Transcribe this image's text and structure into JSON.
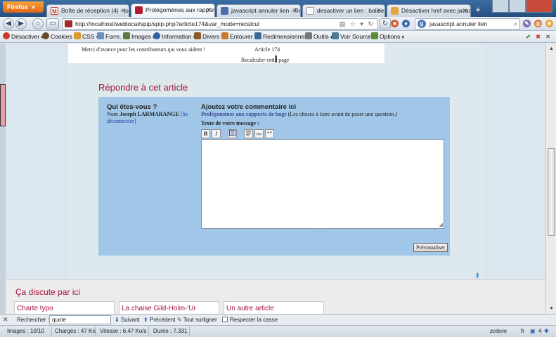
{
  "browser": {
    "menu_button": "Firefox",
    "tabs": [
      {
        "label": "Boîte de réception (4) - jose...",
        "favicon": "gmail-icon",
        "active": false
      },
      {
        "label": "Prolégomènes aux rapports...",
        "favicon": "spip-icon",
        "active": true
      },
      {
        "label": "javascript annuler lien - Rec...",
        "favicon": "page-icon",
        "active": false
      },
      {
        "label": "desactiver un lien : balise \"a...",
        "favicon": "page-icon",
        "active": false
      },
      {
        "label": "Désactiver href avec javascr...",
        "favicon": "page-icon",
        "active": false
      }
    ],
    "new_tab": "+",
    "url": "http://localhost/weblocal/spip/spip.php?article174&var_mode=recalcul",
    "search_value": "javascript annuler lien"
  },
  "dev_toolbar": {
    "items": [
      "Désactiver",
      "Cookies",
      "CSS",
      "Form.",
      "Images",
      "Information",
      "Divers",
      "Entourer",
      "Redimensionner",
      "Outils",
      "Voir Source",
      "Options"
    ]
  },
  "page": {
    "thanks_text": "Merci d'avance pour les contributeurs qui vous aident !",
    "article_number": "Article 174",
    "recalc_text": "Recalculer cette page",
    "reply_title": "Répondre à cet article",
    "who_title": "Qui êtes-vous ?",
    "who_prefix": "Nom",
    "user_name": "Joseph LARMARANGE",
    "logout_link": "[Se déconnecter]",
    "comment_title": "Ajoutez votre commentaire ici",
    "article_link": "Prolégomènes aux rapports de bugs",
    "article_desc": "(Les choses à faire avant de poser une question.)",
    "message_label": "Texte de votre message :",
    "editor_buttons": [
      "B",
      "I",
      "",
      "",
      "«»",
      "“”"
    ],
    "message_value": "",
    "preview_button": "Prévisualiser",
    "discuss_title": "Ça discute par ici",
    "discuss_items": [
      "Charte typo",
      "La chaise Gild-Holm-'Ur",
      "Un autre article"
    ]
  },
  "find_bar": {
    "label": "Rechercher :",
    "value": "quote",
    "next": "Suivant",
    "previous": "Précédent",
    "highlight": "Tout surligner",
    "match_case": "Respecter la casse"
  },
  "status_bar": {
    "images": "Images : 10/10",
    "loaded": "Chargés : 47 Ko",
    "speed": "Vitesse : 6.47 Ko/s",
    "duration": "Durée : 7.331",
    "zotero": "zotero",
    "lang": "fr",
    "count": "4"
  },
  "colors": {
    "accent": "#a5143c",
    "form_bg": "#a1c7e8",
    "link": "#1a3e9c"
  }
}
